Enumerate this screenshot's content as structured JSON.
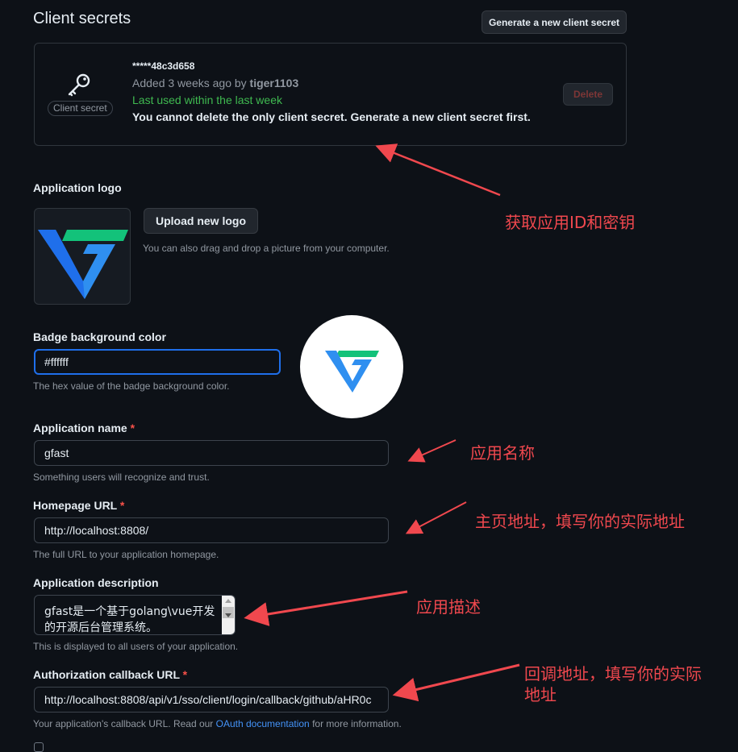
{
  "client_secrets": {
    "heading": "Client secrets",
    "generate_button": "Generate a new client secret",
    "badge": "Client secret",
    "secret_masked": "*****48c3d658",
    "added_prefix": "Added 3 weeks ago by",
    "added_user": "tiger1103",
    "last_used": "Last used within the last week",
    "warning": "You cannot delete the only client secret. Generate a new client secret first.",
    "delete_button": "Delete"
  },
  "logo": {
    "label": "Application logo",
    "upload_button": "Upload new logo",
    "hint": "You can also drag and drop a picture from your computer."
  },
  "badge_color": {
    "label": "Badge background color",
    "value": "#ffffff",
    "hint": "The hex value of the badge background color."
  },
  "app_name": {
    "label": "Application name",
    "required": "*",
    "value": "gfast",
    "hint": "Something users will recognize and trust."
  },
  "homepage": {
    "label": "Homepage URL",
    "required": "*",
    "value": "http://localhost:8808/",
    "hint": "The full URL to your application homepage."
  },
  "description": {
    "label": "Application description",
    "line1": "gfast是一个基于golang\\vue开发",
    "line2": "的开源后台管理系统。",
    "hint": "This is displayed to all users of your application."
  },
  "callback": {
    "label": "Authorization callback URL",
    "required": "*",
    "value": "http://localhost:8808/api/v1/sso/client/login/callback/github/aHR0c",
    "hint_prefix": "Your application's callback URL. Read our",
    "hint_link": "OAuth documentation",
    "hint_suffix": "for more information."
  },
  "annotations": {
    "get_id_secret": "获取应用ID和密钥",
    "app_name": "应用名称",
    "homepage_line": "主页地址，填写你的实际地址",
    "description": "应用描述",
    "callback_line1": "回调地址，填写你的实际",
    "callback_line2": "地址"
  },
  "colors": {
    "background": "#0d1117",
    "accent_blue": "#1f6feb",
    "success_green": "#3fb950",
    "danger_red": "#f85149",
    "annotation_red": "#f0484e",
    "logo_green": "#13c27a",
    "logo_blue": "#2f8ff0"
  }
}
